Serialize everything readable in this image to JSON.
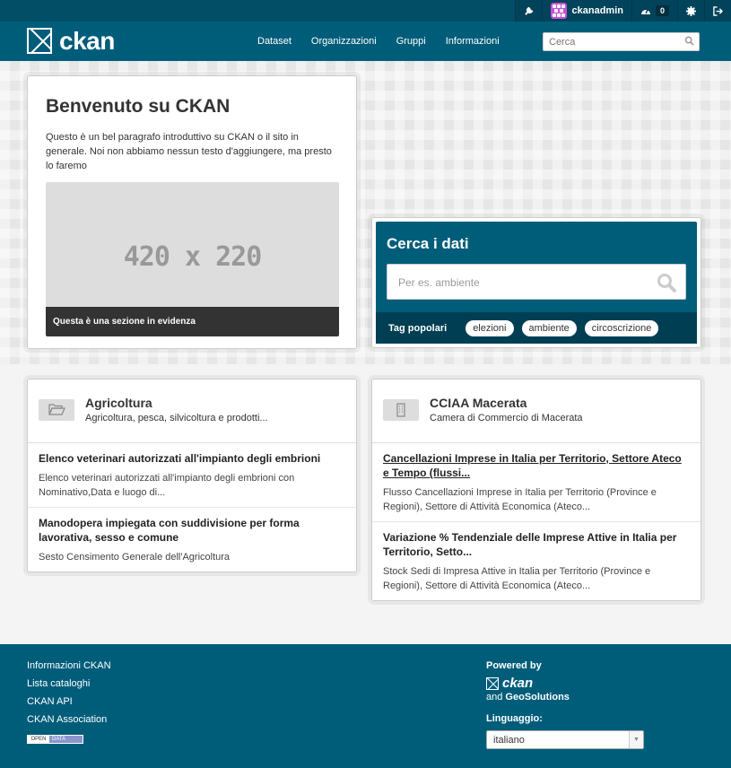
{
  "topbar": {
    "username": "ckanadmin",
    "dashboard_count": "0",
    "icons": [
      "wrench-icon",
      "avatar",
      "dashboard-icon",
      "gear-icon",
      "signout-icon"
    ]
  },
  "header": {
    "logo_text": "ckan",
    "nav": [
      "Dataset",
      "Organizzazioni",
      "Gruppi",
      "Informazioni"
    ],
    "search_placeholder": "Cerca"
  },
  "intro": {
    "title": "Benvenuto su CKAN",
    "text": "Questo è un bel paragrafo introduttivo su CKAN o il sito in generale. Noi non abbiamo nessun testo d'aggiungere, ma presto lo faremo",
    "placeholder_size": "420 x 220",
    "caption": "Questa è una sezione in evidenza"
  },
  "search_panel": {
    "title": "Cerca i dati",
    "placeholder": "Per es. ambiente",
    "tags_label": "Tag popolari",
    "tags": [
      "elezioni",
      "ambiente",
      "circoscrizione"
    ]
  },
  "group_card": {
    "title": "Agricoltura",
    "subtitle": "Agricoltura, pesca, silvicoltura e prodotti...",
    "icon": "folder-open-icon",
    "items": [
      {
        "title": "Elenco veterinari autorizzati all'impianto degli embrioni",
        "desc": "Elenco veterinari autorizzati all'impianto degli embrioni con Nominativo,Data e luogo di..."
      },
      {
        "title": "Manodopera impiegata con suddivisione per forma lavorativa, sesso e comune",
        "desc": "Sesto Censimento Generale dell'Agricoltura"
      }
    ]
  },
  "org_card": {
    "title": "CCIAA Macerata",
    "subtitle": "Camera di Commercio di Macerata",
    "icon": "building-icon",
    "items": [
      {
        "title": "Cancellazioni Imprese in Italia per Territorio, Settore Ateco e Tempo (flussi...",
        "desc": "Flusso Cancellazioni Imprese in Italia per Territorio (Province e Regioni), Settore di Attività Economica (Ateco..."
      },
      {
        "title": "Variazione % Tendenziale delle Imprese Attive in Italia per Territorio, Setto...",
        "desc": "Stock Sedi di Impresa Attive in Italia per Territorio (Province e Regioni), Settore di Attività Economica (Ateco..."
      }
    ]
  },
  "footer": {
    "links": [
      "Informazioni CKAN",
      "Lista cataloghi",
      "CKAN API",
      "CKAN Association"
    ],
    "opendata_badge": [
      "OPEN",
      "DATA"
    ],
    "powered_by": "Powered by",
    "logo_text": "ckan",
    "and_text": "and",
    "geosolutions": "GeoSolutions",
    "language_label": "Linguaggio:",
    "language_value": "italiano"
  },
  "colors": {
    "header": "#005d7a",
    "topbar": "#014e66",
    "tags_bar": "#003f53"
  }
}
